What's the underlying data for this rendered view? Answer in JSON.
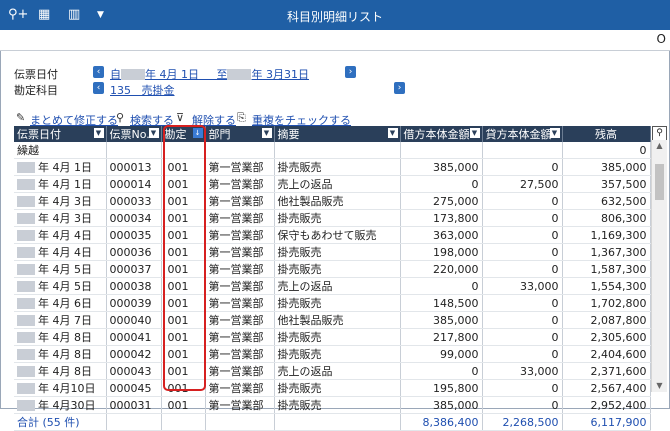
{
  "window": {
    "title": "科目別明細リスト"
  },
  "toolbar_icons": [
    "search-plus-icon",
    "excel-icon",
    "settings-chart-icon",
    "dropdown-icon"
  ],
  "subbar_text": "O",
  "filters": {
    "date_label": "伝票日付",
    "date_from_prefix": "自",
    "date_from": "年  4月 1日",
    "date_to_prefix": "至",
    "date_to": "年  3月31日",
    "account_label": "勘定科目",
    "account_code": "135",
    "account_name": "売掛金"
  },
  "actions": {
    "bulk_edit": "まとめて修正する",
    "search": "検索する",
    "clear": "解除する",
    "check_dup": "重複をチェックする"
  },
  "columns": [
    "伝票日付",
    "伝票No.",
    "勘定",
    "部門",
    "摘要",
    "借方本体金額",
    "貸方本体金額",
    "残高"
  ],
  "carry_row": {
    "label": "繰越",
    "balance": "0"
  },
  "rows": [
    {
      "date": "年  4月  1日",
      "no": "000013",
      "code": "001",
      "dept": "第一営業部",
      "desc": "掛売販売",
      "debit": "385,000",
      "credit": "0",
      "balance": "385,000"
    },
    {
      "date": "年  4月  1日",
      "no": "000014",
      "code": "001",
      "dept": "第一営業部",
      "desc": "売上の返品",
      "debit": "0",
      "credit": "27,500",
      "balance": "357,500"
    },
    {
      "date": "年  4月  3日",
      "no": "000033",
      "code": "001",
      "dept": "第一営業部",
      "desc": "他社製品販売",
      "debit": "275,000",
      "credit": "0",
      "balance": "632,500"
    },
    {
      "date": "年  4月  3日",
      "no": "000034",
      "code": "001",
      "dept": "第一営業部",
      "desc": "掛売販売",
      "debit": "173,800",
      "credit": "0",
      "balance": "806,300"
    },
    {
      "date": "年  4月  4日",
      "no": "000035",
      "code": "001",
      "dept": "第一営業部",
      "desc": "保守もあわせて販売",
      "debit": "363,000",
      "credit": "0",
      "balance": "1,169,300"
    },
    {
      "date": "年  4月  4日",
      "no": "000036",
      "code": "001",
      "dept": "第一営業部",
      "desc": "掛売販売",
      "debit": "198,000",
      "credit": "0",
      "balance": "1,367,300"
    },
    {
      "date": "年  4月  5日",
      "no": "000037",
      "code": "001",
      "dept": "第一営業部",
      "desc": "掛売販売",
      "debit": "220,000",
      "credit": "0",
      "balance": "1,587,300"
    },
    {
      "date": "年  4月  5日",
      "no": "000038",
      "code": "001",
      "dept": "第一営業部",
      "desc": "売上の返品",
      "debit": "0",
      "credit": "33,000",
      "balance": "1,554,300"
    },
    {
      "date": "年  4月  6日",
      "no": "000039",
      "code": "001",
      "dept": "第一営業部",
      "desc": "掛売販売",
      "debit": "148,500",
      "credit": "0",
      "balance": "1,702,800"
    },
    {
      "date": "年  4月  7日",
      "no": "000040",
      "code": "001",
      "dept": "第一営業部",
      "desc": "他社製品販売",
      "debit": "385,000",
      "credit": "0",
      "balance": "2,087,800"
    },
    {
      "date": "年  4月  8日",
      "no": "000041",
      "code": "001",
      "dept": "第一営業部",
      "desc": "掛売販売",
      "debit": "217,800",
      "credit": "0",
      "balance": "2,305,600"
    },
    {
      "date": "年  4月  8日",
      "no": "000042",
      "code": "001",
      "dept": "第一営業部",
      "desc": "掛売販売",
      "debit": "99,000",
      "credit": "0",
      "balance": "2,404,600"
    },
    {
      "date": "年  4月  8日",
      "no": "000043",
      "code": "001",
      "dept": "第一営業部",
      "desc": "売上の返品",
      "debit": "0",
      "credit": "33,000",
      "balance": "2,371,600"
    },
    {
      "date": "年  4月10日",
      "no": "000045",
      "code": "001",
      "dept": "第一営業部",
      "desc": "掛売販売",
      "debit": "195,800",
      "credit": "0",
      "balance": "2,567,400"
    },
    {
      "date": "年  4月30日",
      "no": "000031",
      "code": "001",
      "dept": "第一営業部",
      "desc": "掛売販売",
      "debit": "385,000",
      "credit": "0",
      "balance": "2,952,400"
    }
  ],
  "total": {
    "label": "合計 (55 件)",
    "debit": "8,386,400",
    "credit": "2,268,500",
    "balance": "6,117,900"
  }
}
